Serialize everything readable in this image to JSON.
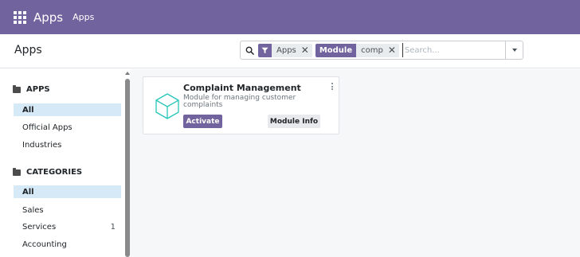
{
  "topbar": {
    "app_title": "Apps",
    "menu_item": "Apps"
  },
  "breadcrumb": {
    "title": "Apps"
  },
  "search": {
    "facets": [
      {
        "label_icon": "filter-icon",
        "value": "Apps"
      },
      {
        "label": "Module",
        "value": "comp"
      }
    ],
    "placeholder": "Search..."
  },
  "sidebar": {
    "apps_header": "APPS",
    "apps_items": [
      {
        "label": "All",
        "active": true
      },
      {
        "label": "Official Apps"
      },
      {
        "label": "Industries"
      }
    ],
    "categories_header": "CATEGORIES",
    "category_items": [
      {
        "label": "All",
        "active": true
      },
      {
        "label": "Sales"
      },
      {
        "label": "Services",
        "count": "1"
      },
      {
        "label": "Accounting"
      }
    ]
  },
  "card": {
    "title": "Complaint Management",
    "description": "Module for managing customer complaints",
    "activate_label": "Activate",
    "info_label": "Module Info"
  },
  "colors": {
    "brand": "#71639e",
    "active_bg": "#d6e9f7",
    "icon_teal": "#26c6b8"
  },
  "icons": {
    "apps_grid": "apps-grid-icon",
    "search": "search-icon",
    "filter": "filter-icon",
    "remove": "close-icon",
    "dropdown": "caret-down-icon",
    "folder": "folder-icon",
    "module": "cube-icon",
    "more": "kebab-icon"
  }
}
